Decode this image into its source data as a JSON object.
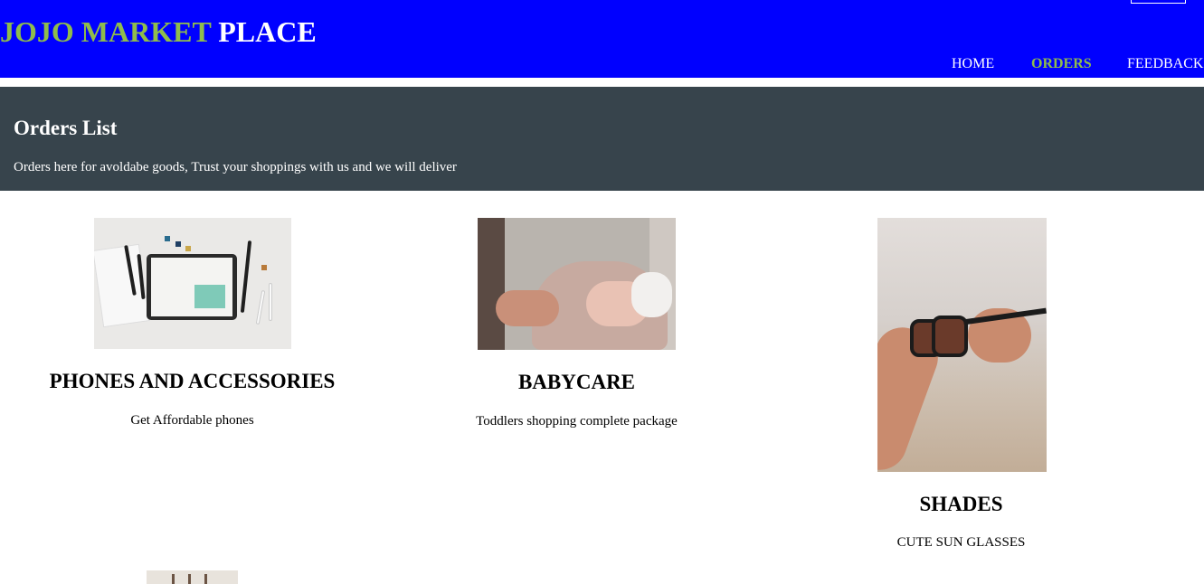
{
  "header": {
    "brand_part1": "JOJO MARKET",
    "brand_part2": "PLACE",
    "nav": [
      {
        "label": "HOME",
        "active": false
      },
      {
        "label": "ORDERS",
        "active": true
      },
      {
        "label": "FEEDBACK",
        "active": false
      }
    ]
  },
  "banner": {
    "title": "Orders List",
    "subtitle": "Orders here for avoldabe goods, Trust your shoppings with us and we will deliver"
  },
  "products": [
    {
      "title": "PHONES AND ACCESSORIES",
      "description": "Get Affordable phones",
      "image": "tablet-and-pens-photo"
    },
    {
      "title": "BABYCARE",
      "description": "Toddlers shopping complete package",
      "image": "baby-in-blanket-photo"
    },
    {
      "title": "SHADES",
      "description": "CUTE SUN GLASSES",
      "image": "sunglasses-in-hands-photo"
    }
  ],
  "colors": {
    "header_bg": "#0000ff",
    "brand_accent": "#8fbc4c",
    "banner_bg": "#37444c"
  }
}
